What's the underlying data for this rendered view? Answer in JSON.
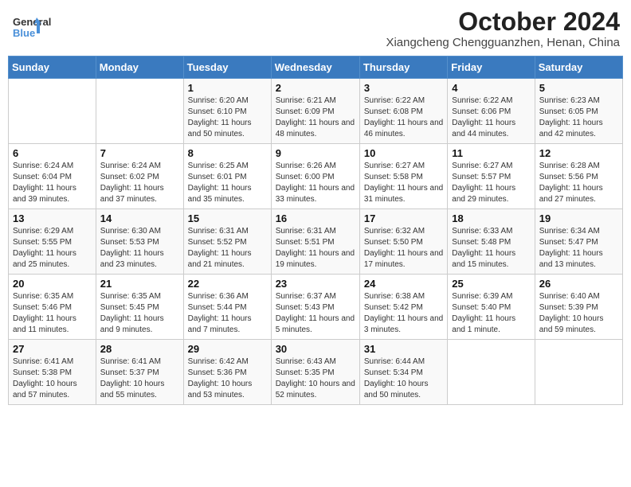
{
  "header": {
    "logo_line1": "General",
    "logo_line2": "Blue",
    "month_title": "October 2024",
    "location": "Xiangcheng Chengguanzhen, Henan, China"
  },
  "weekdays": [
    "Sunday",
    "Monday",
    "Tuesday",
    "Wednesday",
    "Thursday",
    "Friday",
    "Saturday"
  ],
  "weeks": [
    [
      {
        "day": "",
        "sunrise": "",
        "sunset": "",
        "daylight": ""
      },
      {
        "day": "",
        "sunrise": "",
        "sunset": "",
        "daylight": ""
      },
      {
        "day": "1",
        "sunrise": "Sunrise: 6:20 AM",
        "sunset": "Sunset: 6:10 PM",
        "daylight": "Daylight: 11 hours and 50 minutes."
      },
      {
        "day": "2",
        "sunrise": "Sunrise: 6:21 AM",
        "sunset": "Sunset: 6:09 PM",
        "daylight": "Daylight: 11 hours and 48 minutes."
      },
      {
        "day": "3",
        "sunrise": "Sunrise: 6:22 AM",
        "sunset": "Sunset: 6:08 PM",
        "daylight": "Daylight: 11 hours and 46 minutes."
      },
      {
        "day": "4",
        "sunrise": "Sunrise: 6:22 AM",
        "sunset": "Sunset: 6:06 PM",
        "daylight": "Daylight: 11 hours and 44 minutes."
      },
      {
        "day": "5",
        "sunrise": "Sunrise: 6:23 AM",
        "sunset": "Sunset: 6:05 PM",
        "daylight": "Daylight: 11 hours and 42 minutes."
      }
    ],
    [
      {
        "day": "6",
        "sunrise": "Sunrise: 6:24 AM",
        "sunset": "Sunset: 6:04 PM",
        "daylight": "Daylight: 11 hours and 39 minutes."
      },
      {
        "day": "7",
        "sunrise": "Sunrise: 6:24 AM",
        "sunset": "Sunset: 6:02 PM",
        "daylight": "Daylight: 11 hours and 37 minutes."
      },
      {
        "day": "8",
        "sunrise": "Sunrise: 6:25 AM",
        "sunset": "Sunset: 6:01 PM",
        "daylight": "Daylight: 11 hours and 35 minutes."
      },
      {
        "day": "9",
        "sunrise": "Sunrise: 6:26 AM",
        "sunset": "Sunset: 6:00 PM",
        "daylight": "Daylight: 11 hours and 33 minutes."
      },
      {
        "day": "10",
        "sunrise": "Sunrise: 6:27 AM",
        "sunset": "Sunset: 5:58 PM",
        "daylight": "Daylight: 11 hours and 31 minutes."
      },
      {
        "day": "11",
        "sunrise": "Sunrise: 6:27 AM",
        "sunset": "Sunset: 5:57 PM",
        "daylight": "Daylight: 11 hours and 29 minutes."
      },
      {
        "day": "12",
        "sunrise": "Sunrise: 6:28 AM",
        "sunset": "Sunset: 5:56 PM",
        "daylight": "Daylight: 11 hours and 27 minutes."
      }
    ],
    [
      {
        "day": "13",
        "sunrise": "Sunrise: 6:29 AM",
        "sunset": "Sunset: 5:55 PM",
        "daylight": "Daylight: 11 hours and 25 minutes."
      },
      {
        "day": "14",
        "sunrise": "Sunrise: 6:30 AM",
        "sunset": "Sunset: 5:53 PM",
        "daylight": "Daylight: 11 hours and 23 minutes."
      },
      {
        "day": "15",
        "sunrise": "Sunrise: 6:31 AM",
        "sunset": "Sunset: 5:52 PM",
        "daylight": "Daylight: 11 hours and 21 minutes."
      },
      {
        "day": "16",
        "sunrise": "Sunrise: 6:31 AM",
        "sunset": "Sunset: 5:51 PM",
        "daylight": "Daylight: 11 hours and 19 minutes."
      },
      {
        "day": "17",
        "sunrise": "Sunrise: 6:32 AM",
        "sunset": "Sunset: 5:50 PM",
        "daylight": "Daylight: 11 hours and 17 minutes."
      },
      {
        "day": "18",
        "sunrise": "Sunrise: 6:33 AM",
        "sunset": "Sunset: 5:48 PM",
        "daylight": "Daylight: 11 hours and 15 minutes."
      },
      {
        "day": "19",
        "sunrise": "Sunrise: 6:34 AM",
        "sunset": "Sunset: 5:47 PM",
        "daylight": "Daylight: 11 hours and 13 minutes."
      }
    ],
    [
      {
        "day": "20",
        "sunrise": "Sunrise: 6:35 AM",
        "sunset": "Sunset: 5:46 PM",
        "daylight": "Daylight: 11 hours and 11 minutes."
      },
      {
        "day": "21",
        "sunrise": "Sunrise: 6:35 AM",
        "sunset": "Sunset: 5:45 PM",
        "daylight": "Daylight: 11 hours and 9 minutes."
      },
      {
        "day": "22",
        "sunrise": "Sunrise: 6:36 AM",
        "sunset": "Sunset: 5:44 PM",
        "daylight": "Daylight: 11 hours and 7 minutes."
      },
      {
        "day": "23",
        "sunrise": "Sunrise: 6:37 AM",
        "sunset": "Sunset: 5:43 PM",
        "daylight": "Daylight: 11 hours and 5 minutes."
      },
      {
        "day": "24",
        "sunrise": "Sunrise: 6:38 AM",
        "sunset": "Sunset: 5:42 PM",
        "daylight": "Daylight: 11 hours and 3 minutes."
      },
      {
        "day": "25",
        "sunrise": "Sunrise: 6:39 AM",
        "sunset": "Sunset: 5:40 PM",
        "daylight": "Daylight: 11 hours and 1 minute."
      },
      {
        "day": "26",
        "sunrise": "Sunrise: 6:40 AM",
        "sunset": "Sunset: 5:39 PM",
        "daylight": "Daylight: 10 hours and 59 minutes."
      }
    ],
    [
      {
        "day": "27",
        "sunrise": "Sunrise: 6:41 AM",
        "sunset": "Sunset: 5:38 PM",
        "daylight": "Daylight: 10 hours and 57 minutes."
      },
      {
        "day": "28",
        "sunrise": "Sunrise: 6:41 AM",
        "sunset": "Sunset: 5:37 PM",
        "daylight": "Daylight: 10 hours and 55 minutes."
      },
      {
        "day": "29",
        "sunrise": "Sunrise: 6:42 AM",
        "sunset": "Sunset: 5:36 PM",
        "daylight": "Daylight: 10 hours and 53 minutes."
      },
      {
        "day": "30",
        "sunrise": "Sunrise: 6:43 AM",
        "sunset": "Sunset: 5:35 PM",
        "daylight": "Daylight: 10 hours and 52 minutes."
      },
      {
        "day": "31",
        "sunrise": "Sunrise: 6:44 AM",
        "sunset": "Sunset: 5:34 PM",
        "daylight": "Daylight: 10 hours and 50 minutes."
      },
      {
        "day": "",
        "sunrise": "",
        "sunset": "",
        "daylight": ""
      },
      {
        "day": "",
        "sunrise": "",
        "sunset": "",
        "daylight": ""
      }
    ]
  ]
}
